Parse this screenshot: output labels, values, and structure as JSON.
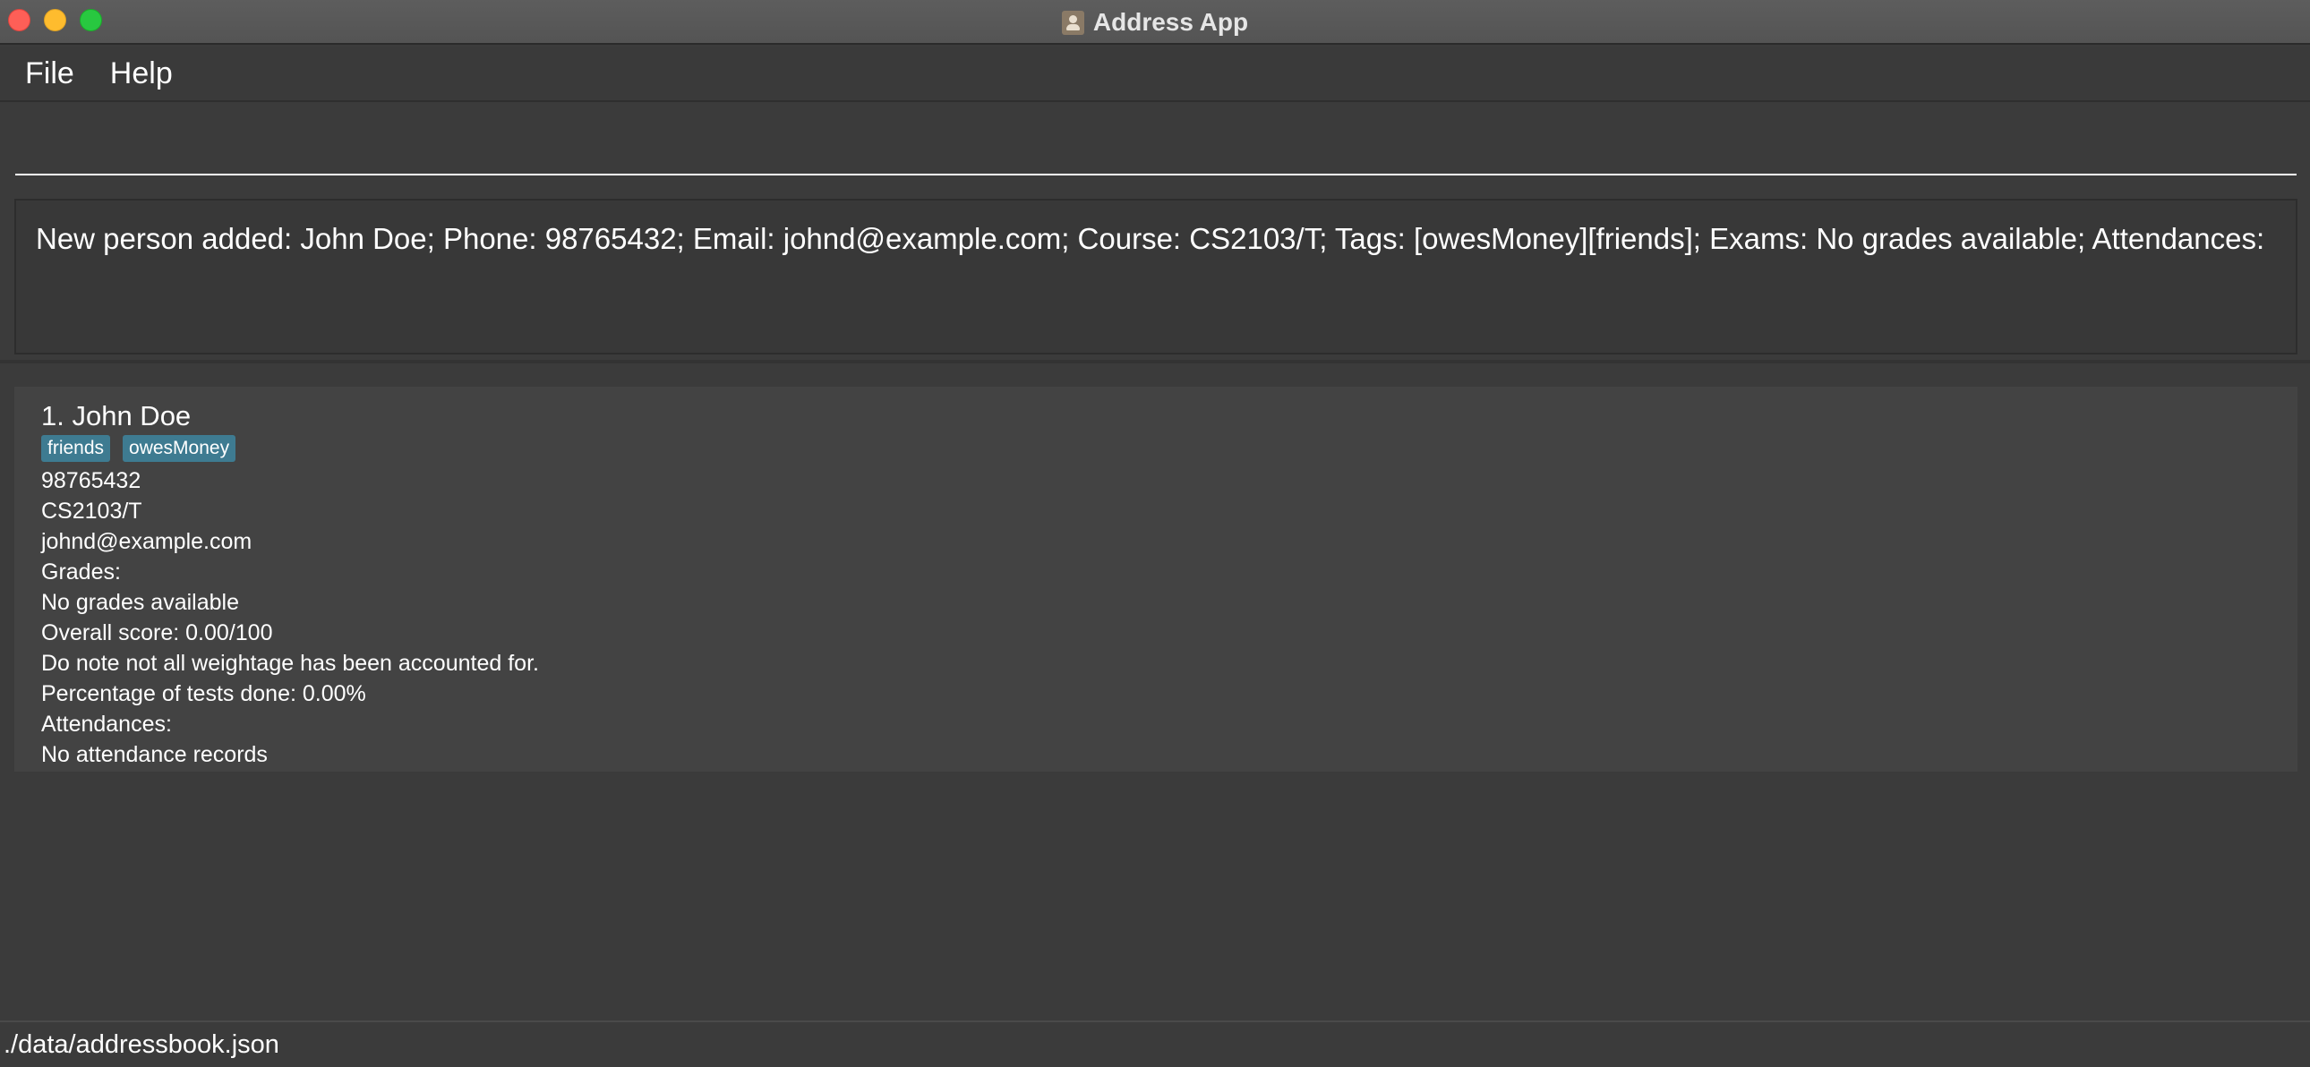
{
  "window": {
    "title": "Address App"
  },
  "menu": {
    "items": [
      "File",
      "Help"
    ]
  },
  "command": {
    "value": ""
  },
  "result": {
    "text": "New person added: John Doe; Phone: 98765432; Email: johnd@example.com; Course: CS2103/T; Tags: [owesMoney][friends]; Exams: No grades available; Attendances:"
  },
  "persons": [
    {
      "name": "1. John Doe",
      "tags": [
        "friends",
        "owesMoney"
      ],
      "phone": "98765432",
      "course": "CS2103/T",
      "email": "johnd@example.com",
      "grades_label": "Grades:",
      "grades": "No grades available",
      "overall_score": "Overall score: 0.00/100",
      "weightage_note": "Do note not all weightage has been accounted for.",
      "tests_done": "Percentage of tests done: 0.00%",
      "attendances_label": "Attendances:",
      "attendances": "No attendance records"
    }
  ],
  "status": {
    "file_path": "./data/addressbook.json"
  },
  "colors": {
    "background": "#3b3b3b",
    "card": "#434343",
    "tag": "#3e7b91",
    "close": "#fe5f57",
    "minimize": "#febc2e",
    "maximize": "#28c840"
  }
}
